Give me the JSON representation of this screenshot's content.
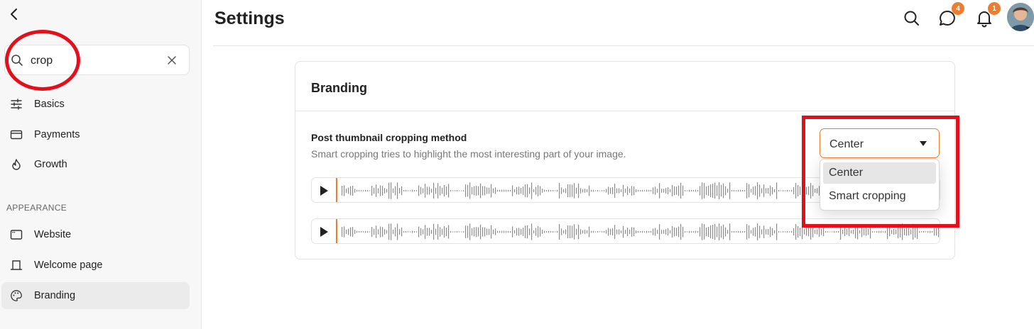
{
  "colors": {
    "accent": "#ef7d2e",
    "annotation": "#e3101c",
    "sidebar_bg": "#f7f7f7"
  },
  "sidebar": {
    "search": {
      "value": "crop",
      "placeholder": ""
    },
    "items": [
      {
        "label": "Basics",
        "icon": "sliders-icon"
      },
      {
        "label": "Payments",
        "icon": "credit-card-icon"
      },
      {
        "label": "Growth",
        "icon": "flame-icon"
      }
    ],
    "section": "APPEARANCE",
    "appearance_items": [
      {
        "label": "Website",
        "icon": "browser-window-icon"
      },
      {
        "label": "Welcome page",
        "icon": "landing-page-icon"
      },
      {
        "label": "Branding",
        "icon": "palette-icon",
        "active": true
      }
    ]
  },
  "header": {
    "title": "Settings",
    "messages_badge": "4",
    "notifications_badge": "1"
  },
  "card": {
    "title": "Branding",
    "setting": {
      "title": "Post thumbnail cropping method",
      "description": "Smart cropping tries to highlight the most interesting part of your image."
    },
    "select": {
      "value": "Center",
      "options": [
        "Center",
        "Smart cropping"
      ]
    }
  }
}
